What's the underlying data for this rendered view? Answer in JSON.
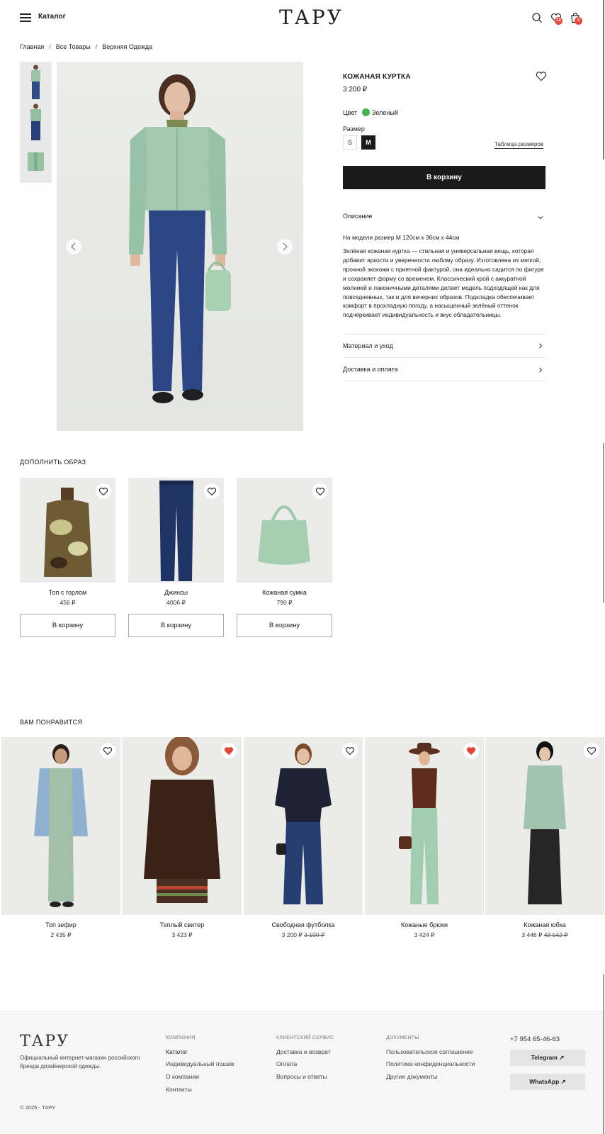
{
  "header": {
    "catalog_label": "Каталог",
    "logo": "ТАРУ",
    "favorites_count": "12",
    "cart_count": "2"
  },
  "breadcrumb": [
    "Главная",
    "Все Товары",
    "Верхняя Одежда"
  ],
  "product": {
    "title": "КОЖАНАЯ КУРТКА",
    "price": "3 200 ₽",
    "color_label": "Цвет",
    "color_name": "Зеленый",
    "color_hex": "#4caf50",
    "size_label": "Размер",
    "sizes": [
      "S",
      "M"
    ],
    "selected_size": "M",
    "size_table_label": "Таблица размеров",
    "add_to_cart": "В корзину",
    "description_title": "Описание",
    "model_info": "На модели размер М 120см х 36см х 44см",
    "description_text": "Зелёная кожаная куртка — стильная и универсальная вещь, которая добавит яркости и уверенности любому образу. Изготовлена из мягкой, прочной экокожи с приятной фактурой, она идеально садится по фигуре и сохраняет форму со временем. Классический крой с аккуратной молнией и лаконичными деталями делает модель подходящей как для повседневных, так и для вечерних образов. Подкладка обеспечивает комфорт в прохладную погоду, а насыщенный зелёный оттенок подчёркивает индивидуальность и вкус обладательницы.",
    "material_title": "Материал и уход",
    "delivery_title": "Доставка и оплата"
  },
  "complete_look": {
    "title": "ДОПОЛНИТЬ ОБРАЗ",
    "items": [
      {
        "name": "Топ с горлом",
        "price": "456 ₽",
        "button": "В корзину"
      },
      {
        "name": "Джинсы",
        "price": "4006 ₽",
        "button": "В корзину"
      },
      {
        "name": "Кожаная сумка",
        "price": "790 ₽",
        "button": "В корзину"
      }
    ]
  },
  "recommendations": {
    "title": "ВАМ ПОНРАВИТСЯ",
    "items": [
      {
        "name": "Топ зефир",
        "price": "2 435 ₽",
        "old_price": "",
        "favorite": false
      },
      {
        "name": "Теплый свитер",
        "price": "3 423 ₽",
        "old_price": "",
        "favorite": true
      },
      {
        "name": "Свободная футболка",
        "price": "3 200 ₽",
        "old_price": "3 100 ₽",
        "favorite": false
      },
      {
        "name": "Кожаные брюки",
        "price": "3 424 ₽",
        "old_price": "",
        "favorite": true
      },
      {
        "name": "Кожаная юбка",
        "price": "3 446 ₽",
        "old_price": "43 542 ₽",
        "favorite": false
      }
    ]
  },
  "footer": {
    "logo": "ТАРУ",
    "tagline": "Официальный интернет-магазин российского бренда дизайнерской одежды.",
    "company_title": "КОМПАНИЯ",
    "company_links": [
      "Каталог",
      "Индивидуальный пошив",
      "О компании",
      "Контакты"
    ],
    "service_title": "КЛИЕНТСКИЙ СЕРВИС",
    "service_links": [
      "Доставка и возврат",
      "Оплата",
      "Вопросы и ответы"
    ],
    "docs_title": "ДОКУМЕНТЫ",
    "docs_links": [
      "Пользовательское соглашение",
      "Политика конфиденциальности",
      "Другие документы"
    ],
    "phone": "+7 954 65-46-63",
    "telegram": "Telegram ↗",
    "whatsapp": "WhatsApp ↗",
    "copyright": "© 2025 - ТАРУ"
  },
  "colors": {
    "accent_dark": "#1a1a1a",
    "favorite_red": "#e0463a",
    "badge_red": "#e04a3a"
  }
}
